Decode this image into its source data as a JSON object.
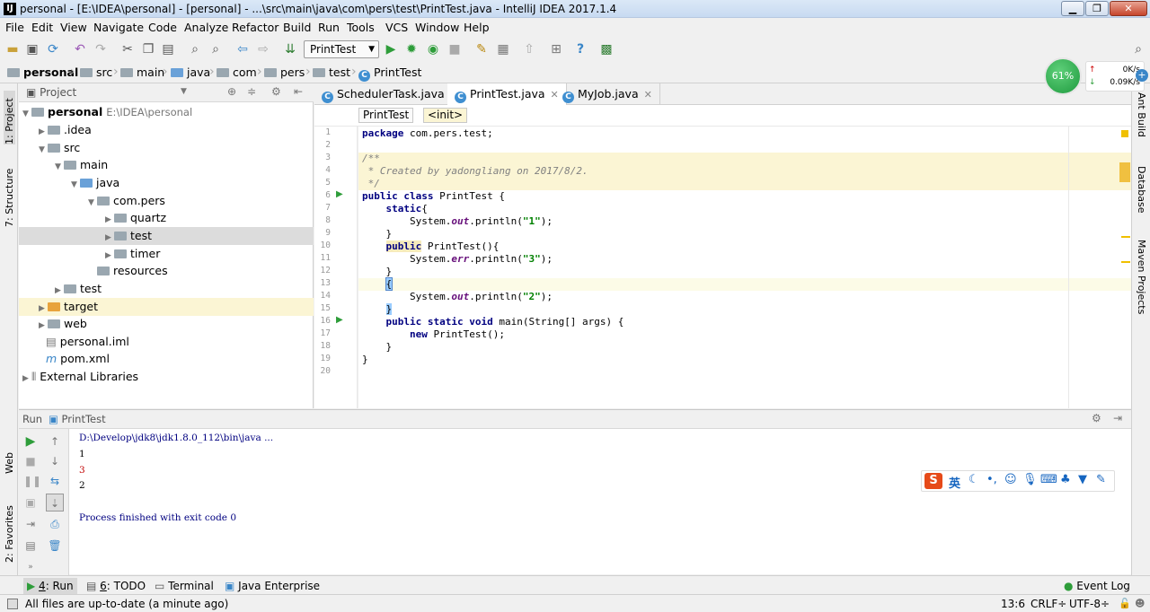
{
  "window": {
    "title": "personal - [E:\\IDEA\\personal] - [personal] - ...\\src\\main\\java\\com\\pers\\test\\PrintTest.java - IntelliJ IDEA 2017.1.4",
    "app_icon": "IJ"
  },
  "menu": [
    "File",
    "Edit",
    "View",
    "Navigate",
    "Code",
    "Analyze",
    "Refactor",
    "Build",
    "Run",
    "Tools",
    "VCS",
    "Window",
    "Help"
  ],
  "toolbar": {
    "run_config": "PrintTest"
  },
  "breadcrumb": [
    "personal",
    "src",
    "main",
    "java",
    "com",
    "pers",
    "test",
    "PrintTest"
  ],
  "project": {
    "header": "Project",
    "tree": [
      {
        "label": "personal",
        "extra": "E:\\IDEA\\personal"
      },
      {
        "label": ".idea"
      },
      {
        "label": "src"
      },
      {
        "label": "main"
      },
      {
        "label": "java"
      },
      {
        "label": "com.pers"
      },
      {
        "label": "quartz"
      },
      {
        "label": "test"
      },
      {
        "label": "timer"
      },
      {
        "label": "resources"
      },
      {
        "label": "test"
      },
      {
        "label": "target"
      },
      {
        "label": "web"
      },
      {
        "label": "personal.iml"
      },
      {
        "label": "pom.xml"
      },
      {
        "label": "External Libraries"
      }
    ]
  },
  "editor": {
    "tabs": [
      "SchedulerTask.java",
      "PrintTest.java",
      "MyJob.java"
    ],
    "crumbs": [
      "PrintTest",
      "<init>"
    ],
    "line_numbers": [
      "1",
      "2",
      "3",
      "4",
      "5",
      "6",
      "7",
      "8",
      "9",
      "10",
      "11",
      "12",
      "13",
      "14",
      "15",
      "16",
      "17",
      "18",
      "19",
      "20"
    ],
    "code": {
      "l1a": "package",
      "l1b": " com.pers.test;",
      "l3": "/**",
      "l4": " * Created by yadongliang on 2017/8/2.",
      "l5": " */",
      "l6a": "public class",
      "l6b": " PrintTest {",
      "l7a": "    ",
      "l7b": "static",
      "l7c": "{",
      "l8a": "        System.",
      "l8b": "out",
      "l8c": ".println(",
      "l8d": "\"1\"",
      "l8e": ");",
      "l9": "    }",
      "l10a": "    ",
      "l10b": "public",
      "l10c": " PrintTest(){",
      "l11a": "        System.",
      "l11b": "err",
      "l11c": ".println(",
      "l11d": "\"3\"",
      "l11e": ");",
      "l12": "    }",
      "l13a": "    ",
      "l13b": "{",
      "l14a": "        System.",
      "l14b": "out",
      "l14c": ".println(",
      "l14d": "\"2\"",
      "l14e": ");",
      "l15a": "    ",
      "l15b": "}",
      "l16a": "    ",
      "l16b": "public static void",
      "l16c": " main(String[] args) {",
      "l17a": "        ",
      "l17b": "new",
      "l17c": " PrintTest();",
      "l18": "    }",
      "l19": "}"
    }
  },
  "right_tabs": [
    "Ant Build",
    "Database",
    "Maven Projects"
  ],
  "left_tabs": [
    "1: Project",
    "7: Structure",
    "Web",
    "2: Favorites"
  ],
  "run": {
    "label": "Run",
    "config": "PrintTest",
    "output": [
      {
        "text": "D:\\Develop\\jdk8\\jdk1.8.0_112\\bin\\java ...",
        "color": "#000080"
      },
      {
        "text": "1",
        "color": "#000000"
      },
      {
        "text": "3",
        "color": "#c00000"
      },
      {
        "text": "2",
        "color": "#000000"
      },
      {
        "text": "",
        "color": "#000000"
      },
      {
        "text": "Process finished with exit code 0",
        "color": "#000080"
      }
    ]
  },
  "bottom_tabs": [
    {
      "num": "4",
      "label": ": Run"
    },
    {
      "num": "6",
      "label": ": TODO"
    },
    {
      "num": "",
      "label": "Terminal"
    },
    {
      "num": "",
      "label": "Java Enterprise"
    }
  ],
  "event_log": "Event Log",
  "status": {
    "message": "All files are up-to-date (a minute ago)",
    "position": "13:6",
    "line_sep": "CRLF÷",
    "encoding": "UTF-8÷"
  },
  "netmon": {
    "percent": "61%",
    "up": "0K/s",
    "down": "0.09K/s"
  },
  "ime": {
    "lang": "英"
  }
}
